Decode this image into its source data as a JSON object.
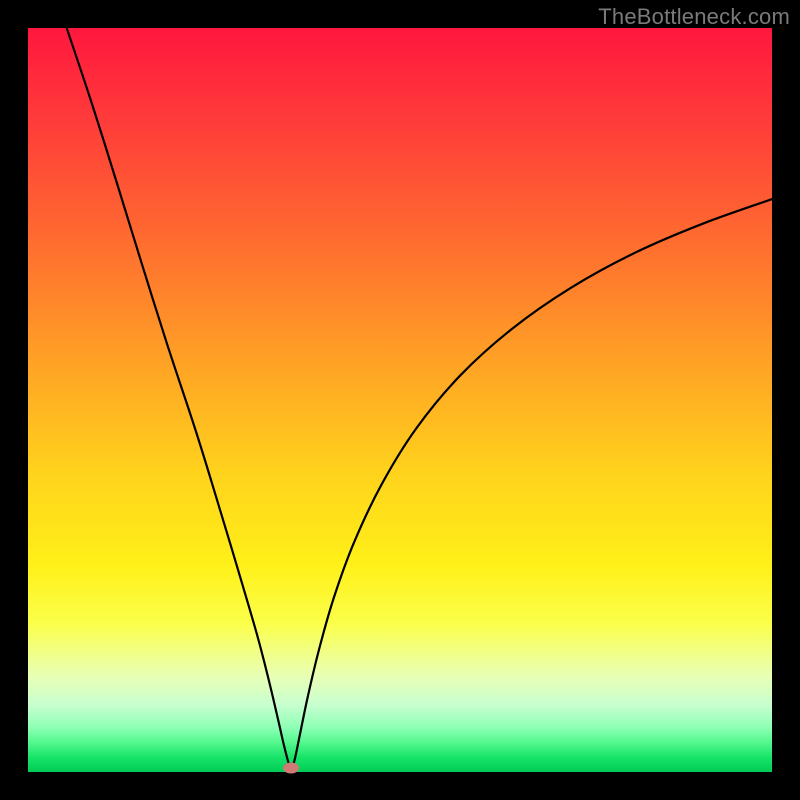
{
  "watermark": "TheBottleneck.com",
  "dot": {
    "x_pct": 35.3,
    "y_pct": 98.8
  },
  "chart_data": {
    "type": "line",
    "title": "",
    "xlabel": "",
    "ylabel": "",
    "xlim": [
      0,
      100
    ],
    "ylim": [
      0,
      100
    ],
    "curve": [
      {
        "x": 5.2,
        "y": 100.0
      },
      {
        "x": 8.6,
        "y": 89.8
      },
      {
        "x": 12.0,
        "y": 79.0
      },
      {
        "x": 15.3,
        "y": 68.3
      },
      {
        "x": 18.7,
        "y": 57.5
      },
      {
        "x": 22.6,
        "y": 45.7
      },
      {
        "x": 25.7,
        "y": 35.6
      },
      {
        "x": 28.4,
        "y": 26.6
      },
      {
        "x": 30.8,
        "y": 18.4
      },
      {
        "x": 32.4,
        "y": 12.2
      },
      {
        "x": 33.6,
        "y": 7.1
      },
      {
        "x": 34.4,
        "y": 3.6
      },
      {
        "x": 35.0,
        "y": 1.3
      },
      {
        "x": 35.3,
        "y": 0.5
      },
      {
        "x": 35.8,
        "y": 1.5
      },
      {
        "x": 36.5,
        "y": 4.8
      },
      {
        "x": 37.6,
        "y": 10.1
      },
      {
        "x": 39.1,
        "y": 16.4
      },
      {
        "x": 41.1,
        "y": 23.4
      },
      {
        "x": 43.8,
        "y": 30.8
      },
      {
        "x": 47.5,
        "y": 38.6
      },
      {
        "x": 52.2,
        "y": 46.2
      },
      {
        "x": 58.1,
        "y": 53.3
      },
      {
        "x": 65.1,
        "y": 59.6
      },
      {
        "x": 73.0,
        "y": 65.1
      },
      {
        "x": 81.6,
        "y": 69.8
      },
      {
        "x": 90.7,
        "y": 73.7
      },
      {
        "x": 100.0,
        "y": 77.0
      }
    ],
    "minimum_marker": {
      "x": 35.3,
      "y": 0.5
    },
    "background_gradient": {
      "top": "#ff173e",
      "bottom": "#00cc55"
    }
  }
}
